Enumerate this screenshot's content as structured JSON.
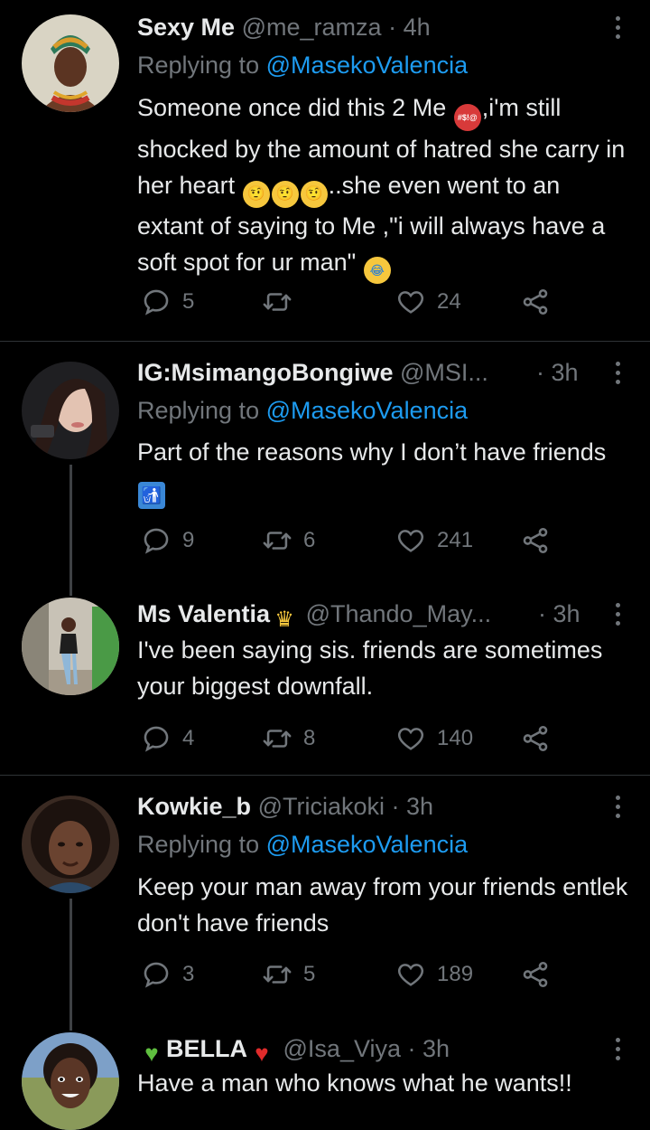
{
  "icons": {
    "reply": "reply-icon",
    "retweet": "retweet-icon",
    "like": "heart-icon",
    "share": "share-icon",
    "more": "more-icon"
  },
  "colors": {
    "background": "#000000",
    "accent": "#1d9bf0",
    "muted": "#71767b",
    "text": "#e7e9ea"
  },
  "tweets": [
    {
      "name": "Sexy Me",
      "handle": "@me_ramza",
      "dot": "·",
      "time": "4h",
      "replying_prefix": "Replying to ",
      "replying_to": "@MasekoValencia",
      "body": {
        "p1": "Someone once did this 2 Me",
        "p2": ",i'm still shocked by the amount of hatred she carry in her heart",
        "p3": "..she even went to an extant of saying  to Me ,\"i will always have a soft spot for ur man\""
      },
      "replies": "5",
      "retweets": "",
      "likes": "24"
    },
    {
      "name": "IG:MsimangoBongiwe",
      "handle": "@MSI...",
      "dot": "·",
      "time": "3h",
      "replying_prefix": "Replying to ",
      "replying_to": "@MasekoValencia",
      "body": {
        "p1": "Part of the reasons why I don’t have friends"
      },
      "replies": "9",
      "retweets": "6",
      "likes": "241"
    },
    {
      "name": "Ms Valentia",
      "handle": "@Thando_May...",
      "dot": "·",
      "time": "3h",
      "body": {
        "p1": "I've been saying sis.  friends are sometimes your biggest downfall."
      },
      "replies": "4",
      "retweets": "8",
      "likes": "140"
    },
    {
      "name": "Kowkie_b",
      "handle": "@Triciakoki",
      "dot": "·",
      "time": "3h",
      "replying_prefix": "Replying to ",
      "replying_to": "@MasekoValencia",
      "body": {
        "p1": "Keep your man away from your friends entlek don't have friends"
      },
      "replies": "3",
      "retweets": "5",
      "likes": "189"
    },
    {
      "name": "BELLA",
      "handle": "@Isa_Viya",
      "dot": "·",
      "time": "3h",
      "body": {
        "p1": "Have a man who knows what he wants!!"
      }
    }
  ]
}
